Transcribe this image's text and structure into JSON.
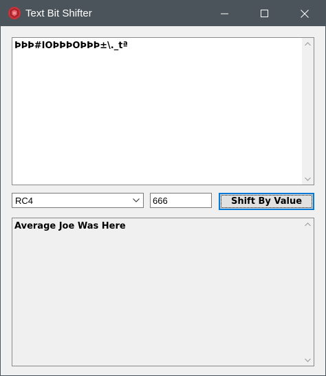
{
  "window": {
    "title": "Text Bit Shifter",
    "icon": "app-logo-icon",
    "controls": {
      "minimize": "minimize-icon",
      "maximize": "maximize-icon",
      "close": "close-icon"
    }
  },
  "input_text": "ÞÞÞ#ÌOÞÞÞOÞÞÞ±\\._tª",
  "algorithm": {
    "selected": "RC4",
    "icon": "chevron-down-icon"
  },
  "shift_value": "666",
  "shift_button": {
    "label": "Shift By Value"
  },
  "output_text": "Average Joe Was Here",
  "colors": {
    "titlebar": "#4b545b",
    "client_bg": "#f0f0f0",
    "focus_border": "#0078d7",
    "input_bg": "#ffffff",
    "readonly_bg": "#f0f0f0"
  }
}
